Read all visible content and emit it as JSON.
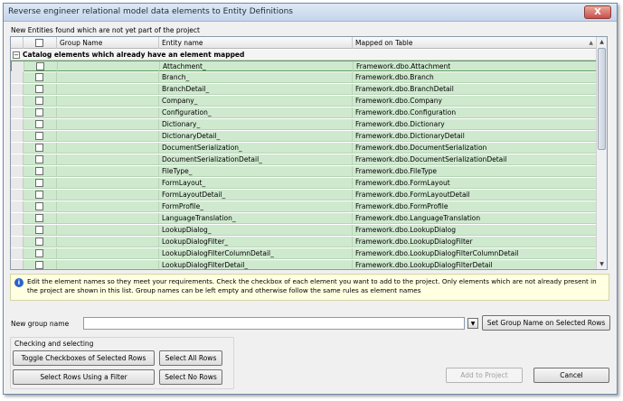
{
  "window": {
    "title": "Reverse engineer relational model data elements to Entity Definitions",
    "close_glyph": "X"
  },
  "grid": {
    "caption": "New Entities found which are not yet part of the project",
    "columns": [
      "Group Name",
      "Entity name",
      "Mapped on Table"
    ],
    "group_header": "Catalog elements which already have an element mapped",
    "collapse_glyph": "−",
    "sort_glyph": "▲",
    "rows": [
      {
        "entity": "Attachment_",
        "table": "Framework.dbo.Attachment"
      },
      {
        "entity": "Branch_",
        "table": "Framework.dbo.Branch"
      },
      {
        "entity": "BranchDetail_",
        "table": "Framework.dbo.BranchDetail"
      },
      {
        "entity": "Company_",
        "table": "Framework.dbo.Company"
      },
      {
        "entity": "Configuration_",
        "table": "Framework.dbo.Configuration"
      },
      {
        "entity": "Dictionary_",
        "table": "Framework.dbo.Dictionary"
      },
      {
        "entity": "DictionaryDetail_",
        "table": "Framework.dbo.DictionaryDetail"
      },
      {
        "entity": "DocumentSerialization_",
        "table": "Framework.dbo.DocumentSerialization"
      },
      {
        "entity": "DocumentSerializationDetail_",
        "table": "Framework.dbo.DocumentSerializationDetail"
      },
      {
        "entity": "FileType_",
        "table": "Framework.dbo.FileType"
      },
      {
        "entity": "FormLayout_",
        "table": "Framework.dbo.FormLayout"
      },
      {
        "entity": "FormLayoutDetail_",
        "table": "Framework.dbo.FormLayoutDetail"
      },
      {
        "entity": "FormProfile_",
        "table": "Framework.dbo.FormProfile"
      },
      {
        "entity": "LanguageTranslation_",
        "table": "Framework.dbo.LanguageTranslation"
      },
      {
        "entity": "LookupDialog_",
        "table": "Framework.dbo.LookupDialog"
      },
      {
        "entity": "LookupDialogFilter_",
        "table": "Framework.dbo.LookupDialogFilter"
      },
      {
        "entity": "LookupDialogFilterColumnDetail_",
        "table": "Framework.dbo.LookupDialogFilterColumnDetail"
      },
      {
        "entity": "LookupDialogFilterDetail_",
        "table": "Framework.dbo.LookupDialogFilterDetail"
      }
    ]
  },
  "scroll": {
    "up": "▲",
    "down": "▼"
  },
  "info": {
    "icon": "i",
    "text": "Edit the element names so they meet your requirements. Check the checkbox of each element you want to add to the project. Only elements which are not already present in the project are shown in this list. Group names can be left empty and otherwise follow the same rules as element names"
  },
  "group_name": {
    "label": "New group name",
    "value": "",
    "dropdown_glyph": "▼",
    "set_button": "Set Group Name on Selected Rows"
  },
  "checking": {
    "legend": "Checking and selecting",
    "toggle": "Toggle Checkboxes of Selected Rows",
    "select_all": "Select All Rows",
    "select_filter": "Select Rows Using a Filter",
    "select_none": "Select No Rows"
  },
  "footer": {
    "add": "Add to Project",
    "cancel": "Cancel"
  }
}
